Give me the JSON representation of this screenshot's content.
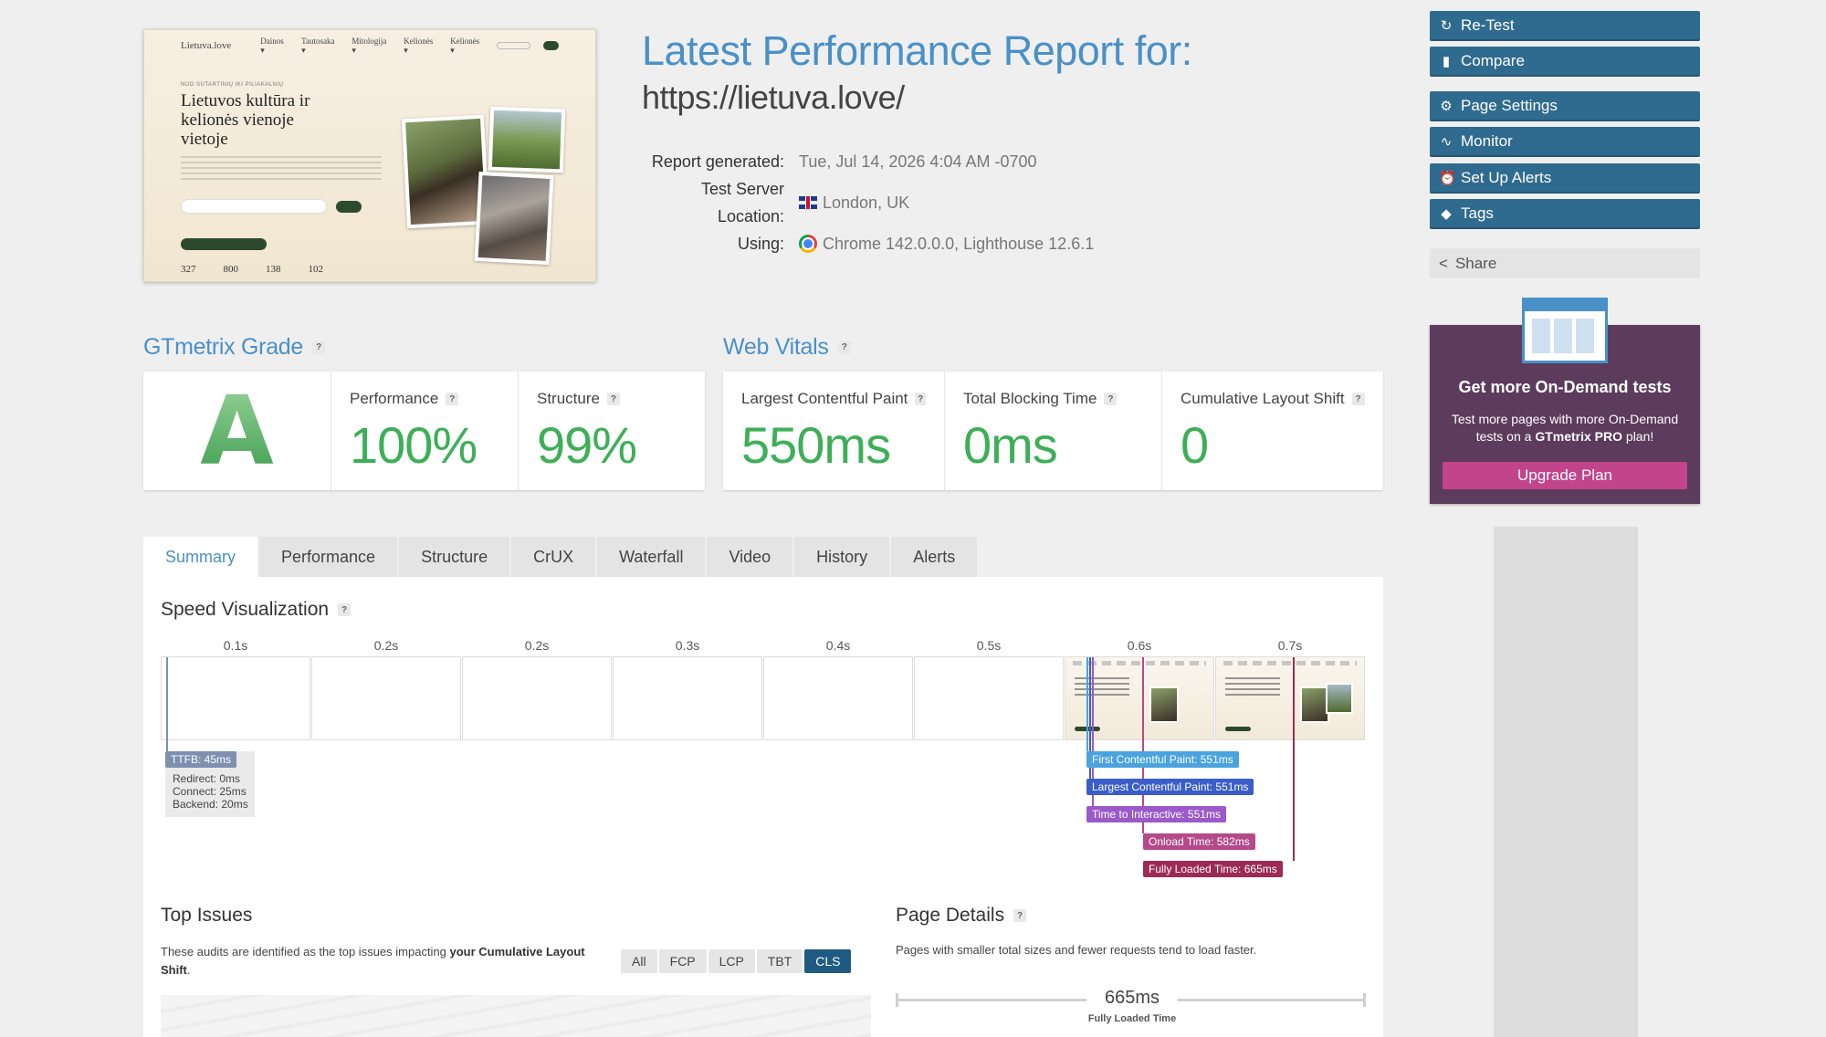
{
  "thumbnail": {
    "logo": "Lietuva.love",
    "nav": [
      "Dainos ▾",
      "Tautosaka ▾",
      "Mitologija ▾",
      "Kelionės ▾",
      "Kelionės ▾"
    ],
    "kicker": "NUO SUTARTINIŲ IKI PILIAKALNIŲ",
    "title": "Lietuvos kultūra ir kelionės vienoje vietoje",
    "stats": [
      "327",
      "800",
      "138",
      "102"
    ]
  },
  "header": {
    "title": "Latest Performance Report for:",
    "url": "https://lietuva.love/"
  },
  "meta": {
    "generated_label": "Report generated:",
    "generated_value": "Tue, Jul 14, 2026 4:04 AM -0700",
    "location_label": "Test Server Location:",
    "location_value": "London, UK",
    "using_label": "Using:",
    "using_value": "Chrome 142.0.0.0, Lighthouse 12.6.1"
  },
  "actions": {
    "retest": "Re-Test",
    "compare": "Compare",
    "page_settings": "Page Settings",
    "monitor": "Monitor",
    "alerts": "Set Up Alerts",
    "tags": "Tags",
    "share": "Share"
  },
  "promo": {
    "title": "Get more On-Demand tests",
    "text_1": "Test more pages with more On-Demand tests on a ",
    "text_bold": "GTmetrix PRO",
    "text_2": " plan!",
    "button": "Upgrade Plan"
  },
  "grade": {
    "title": "GTmetrix Grade",
    "letter": "A",
    "performance_label": "Performance",
    "performance_value": "100%",
    "structure_label": "Structure",
    "structure_value": "99%"
  },
  "vitals": {
    "title": "Web Vitals",
    "lcp_label": "Largest Contentful Paint",
    "lcp_value": "550ms",
    "tbt_label": "Total Blocking Time",
    "tbt_value": "0ms",
    "cls_label": "Cumulative Layout Shift",
    "cls_value": "0"
  },
  "tabs": [
    "Summary",
    "Performance",
    "Structure",
    "CrUX",
    "Waterfall",
    "Video",
    "History",
    "Alerts"
  ],
  "speed_viz": {
    "title": "Speed Visualization",
    "frame_times": [
      "0.1s",
      "0.2s",
      "0.2s",
      "0.3s",
      "0.4s",
      "0.5s",
      "0.6s",
      "0.7s"
    ],
    "ttfb": "TTFB: 45ms",
    "redirect": "Redirect: 0ms",
    "connect": "Connect: 25ms",
    "backend": "Backend: 20ms",
    "fcp": "First Contentful Paint: 551ms",
    "lcp": "Largest Contentful Paint: 551ms",
    "tti": "Time to Interactive: 551ms",
    "onload": "Onload Time: 582ms",
    "fully_loaded": "Fully Loaded Time: 665ms"
  },
  "top_issues": {
    "title": "Top Issues",
    "text": "These audits are identified as the top issues impacting ",
    "text_bold": "your Cumulative Layout Shift",
    "text_end": ".",
    "filters": [
      "All",
      "FCP",
      "LCP",
      "TBT",
      "CLS"
    ],
    "active_filter": "CLS"
  },
  "page_details": {
    "title": "Page Details",
    "text": "Pages with smaller total sizes and fewer requests tend to load faster.",
    "value": "665ms",
    "label": "Fully Loaded Time"
  },
  "colors": {
    "accent": "#4a90c8",
    "button": "#2f6b8f",
    "grade_green": "#3daf57",
    "promo_bg": "#5c3b5c",
    "upgrade": "#c2448a",
    "fcp": "#4aa3df",
    "lcp": "#3b5dc9",
    "tti": "#9b59c9",
    "onload": "#b44a8a",
    "fully_loaded": "#9c2a55"
  }
}
